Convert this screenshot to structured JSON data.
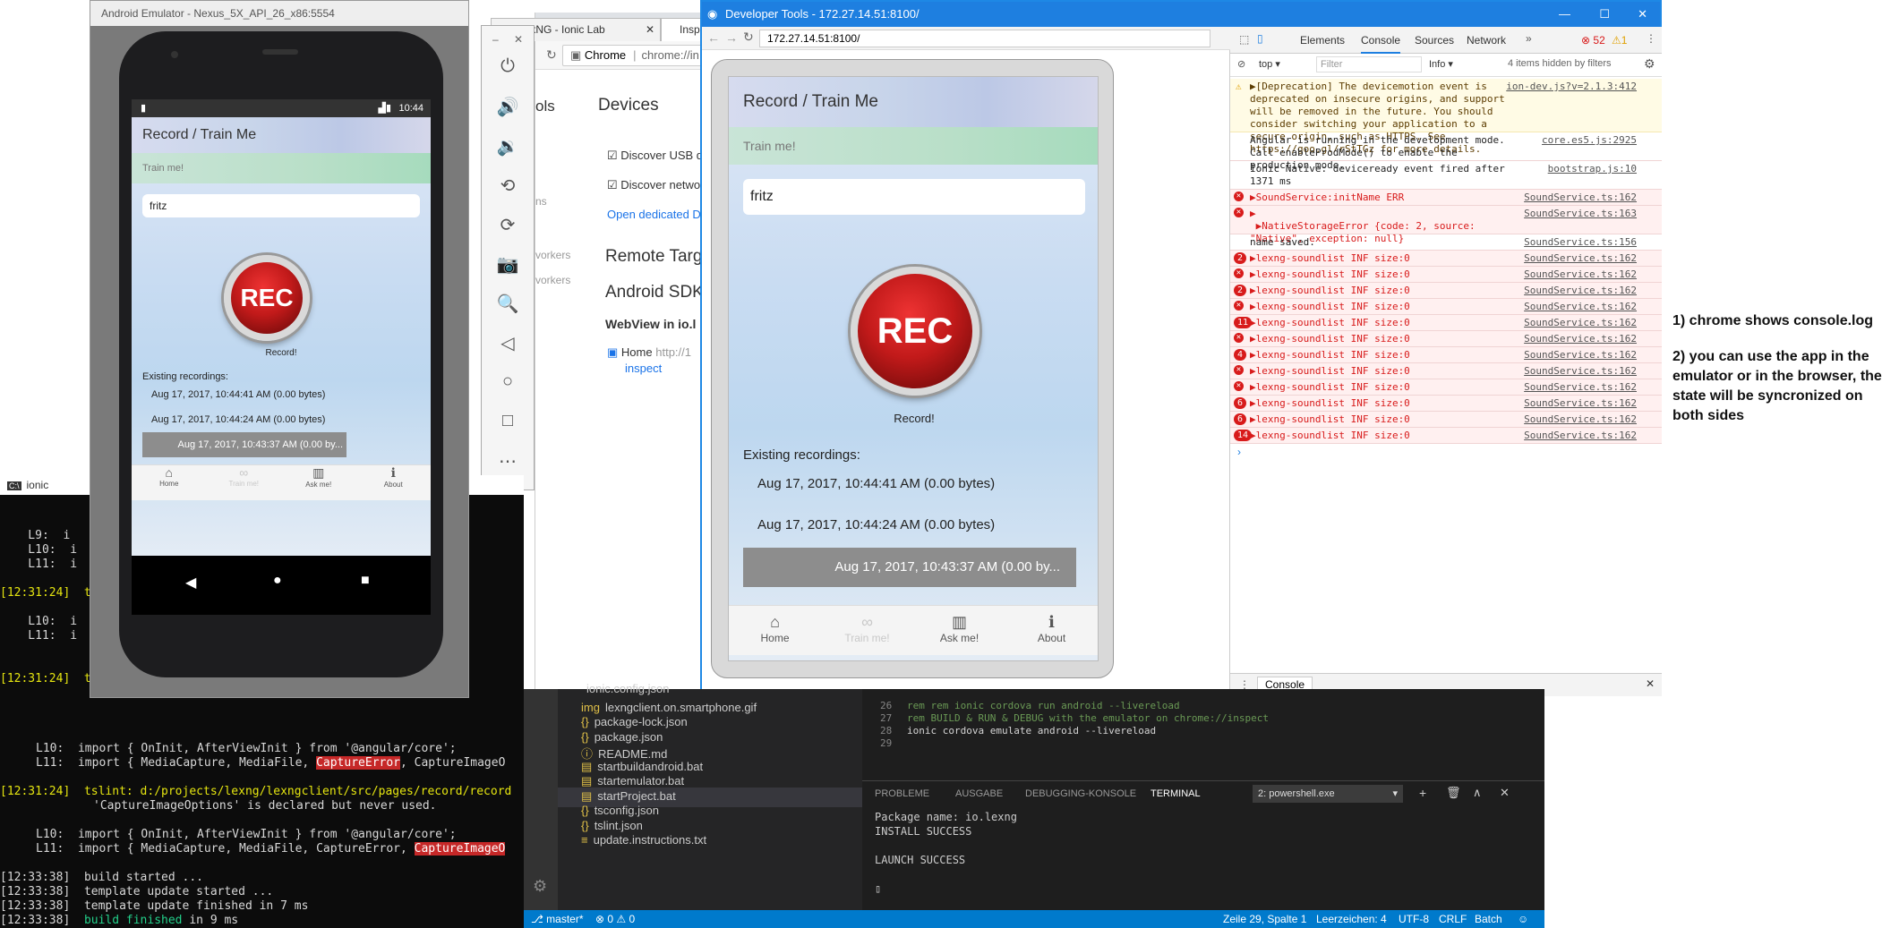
{
  "terminal": {
    "title": "ionic",
    "lines": [
      {
        "prefix": "",
        "text": "    L9:  i"
      },
      {
        "prefix": "",
        "text": "    L10:  i"
      },
      {
        "prefix": "",
        "text": "    L11:  i"
      },
      {
        "prefix": "[12:31:24]",
        "text": "  t"
      },
      {
        "prefix": "",
        "text": "    L10:  i"
      },
      {
        "prefix": "",
        "text": "    L11:  i"
      },
      {
        "prefix": "[12:31:24]",
        "text": "  t"
      }
    ],
    "code1_l10": "L10:  import { OnInit, AfterViewInit } from '@angular/core';",
    "code1_l11_a": "L11:  import { MediaCapture, MediaFile, ",
    "code1_l11_b": "CaptureError",
    "code1_l11_c": ", CaptureImageO",
    "tslint_time": "[12:31:24]",
    "tslint_msg": "tslint: d:/projects/lexng/lexngclient/src/pages/record/record",
    "tslint_msg2": "'CaptureImageOptions' is declared but never used.",
    "code2_l10": "L10:  import { OnInit, AfterViewInit } from '@angular/core';",
    "code2_l11_a": "L11:  import { MediaCapture, MediaFile, CaptureError, ",
    "code2_l11_b": "CaptureImageO",
    "build": [
      {
        "time": "[12:33:38]",
        "msg": "build started ..."
      },
      {
        "time": "[12:33:38]",
        "msg": "template update started ..."
      },
      {
        "time": "[12:33:38]",
        "msg": "template update finished in 7 ms"
      },
      {
        "time": "[12:33:38]",
        "msg": "build finished",
        "suffix": " in 9 ms"
      }
    ]
  },
  "emulator": {
    "title": "Android Emulator - Nexus_5X_API_26_x86:5554",
    "clock": "10:44"
  },
  "app": {
    "header": "Record / Train Me",
    "subheader": "Train me!",
    "name_value": "fritz",
    "rec_label": "REC",
    "record_caption": "Record!",
    "recordings_title": "Existing recordings:",
    "recordings": [
      "Aug 17, 2017, 10:44:41 AM (0.00 bytes)",
      "Aug 17, 2017, 10:44:24 AM (0.00 bytes)"
    ],
    "selected_small": "Aug 17, 2017, 10:43:37 AM (0.00 by...",
    "selected_large": "Aug 17, 2017, 10:43:37 AM (0.00 b...",
    "tabs": [
      {
        "label": "Home",
        "icon": "home-icon",
        "glyph": "⌂"
      },
      {
        "label": "Train me!",
        "icon": "train-icon",
        "glyph": "∞"
      },
      {
        "label": "Ask me!",
        "icon": "barcode-icon",
        "glyph": "▥"
      },
      {
        "label": "About",
        "icon": "info-icon",
        "glyph": "ℹ"
      }
    ]
  },
  "browser": {
    "tab1": "lexNG - Ionic Lab",
    "tab2": "Insp",
    "omnibox_chrome": "Chrome",
    "omnibox_url": "chrome://in"
  },
  "inspect": {
    "ols": "ols",
    "devices": "Devices",
    "discover_usb": "Discover USB d",
    "discover_network": "Discover netwo",
    "open_dedicated": "Open dedicated D",
    "ns": "ns",
    "workers1": "vorkers",
    "workers2": "vorkers",
    "remote": "Remote Targ",
    "android_sdk": "Android SDK",
    "webview": "WebView in io.l",
    "home": "Home",
    "home_url": "http://1",
    "inspect_link": "inspect"
  },
  "devtools": {
    "title": "Developer Tools - 172.27.14.51:8100/",
    "url": "172.27.14.51:8100/",
    "tabs": [
      "Elements",
      "Console",
      "Sources",
      "Network"
    ],
    "error_count": "52",
    "warn_count": "1",
    "context": "top",
    "filter_placeholder": "Filter",
    "level": "Info",
    "hidden": "4 items hidden by filters",
    "drawer_tab": "Console",
    "logs": [
      {
        "type": "warn",
        "count": "",
        "text": "▶[Deprecation] The devicemotion event is deprecated on insecure origins, and support will be removed in the future. You should consider switching your application to a secure origin, such as HTTPS. See https://goo.gl/rStTGz for more details.",
        "src": "ion-dev.js?v=2.1.3:412",
        "lines": 4
      },
      {
        "type": "info",
        "count": "",
        "text": "Angular is running in the development mode. Call enableProdMode() to enable the production mode.",
        "src": "core.es5.js:2925",
        "lines": 2
      },
      {
        "type": "info",
        "count": "",
        "text": "Ionic Native: deviceready event fired after 1371 ms",
        "src": "bootstrap.js:10",
        "lines": 2
      },
      {
        "type": "err",
        "count": "x",
        "text": "▶SoundService:initName ERR",
        "src": "SoundService.ts:162",
        "lines": 1
      },
      {
        "type": "err",
        "count": "x",
        "text": "▶\n ▶NativeStorageError {code: 2, source: \"Native\", exception: null}",
        "src": "SoundService.ts:163",
        "lines": 2
      },
      {
        "type": "info",
        "count": "",
        "text": "name saved.",
        "src": "SoundService.ts:156",
        "lines": 1
      },
      {
        "type": "err",
        "count": "2",
        "text": "▶lexng-soundlist INF size:0",
        "src": "SoundService.ts:162",
        "lines": 1
      },
      {
        "type": "err",
        "count": "x",
        "text": "▶lexng-soundlist INF size:0",
        "src": "SoundService.ts:162",
        "lines": 1
      },
      {
        "type": "err",
        "count": "2",
        "text": "▶lexng-soundlist INF size:0",
        "src": "SoundService.ts:162",
        "lines": 1
      },
      {
        "type": "err",
        "count": "x",
        "text": "▶lexng-soundlist INF size:0",
        "src": "SoundService.ts:162",
        "lines": 1
      },
      {
        "type": "err",
        "count": "11",
        "text": "▶lexng-soundlist INF size:0",
        "src": "SoundService.ts:162",
        "lines": 1
      },
      {
        "type": "err",
        "count": "x",
        "text": "▶lexng-soundlist INF size:0",
        "src": "SoundService.ts:162",
        "lines": 1
      },
      {
        "type": "err",
        "count": "4",
        "text": "▶lexng-soundlist INF size:0",
        "src": "SoundService.ts:162",
        "lines": 1
      },
      {
        "type": "err",
        "count": "x",
        "text": "▶lexng-soundlist INF size:0",
        "src": "SoundService.ts:162",
        "lines": 1
      },
      {
        "type": "err",
        "count": "x",
        "text": "▶lexng-soundlist INF size:0",
        "src": "SoundService.ts:162",
        "lines": 1
      },
      {
        "type": "err",
        "count": "6",
        "text": "▶lexng-soundlist INF size:0",
        "src": "SoundService.ts:162",
        "lines": 1
      },
      {
        "type": "err",
        "count": "6",
        "text": "▶lexng-soundlist INF size:0",
        "src": "SoundService.ts:162",
        "lines": 1
      },
      {
        "type": "err",
        "count": "14",
        "text": "▶lexng-soundlist INF size:0",
        "src": "SoundService.ts:162",
        "lines": 1
      }
    ]
  },
  "vscode": {
    "files": [
      {
        "icon": "",
        "name": "ionic.config.json"
      },
      {
        "icon": "img",
        "name": "lexngclient.on.smartphone.gif"
      },
      {
        "icon": "{}",
        "name": "package-lock.json"
      },
      {
        "icon": "{}",
        "name": "package.json"
      },
      {
        "icon": "ⓘ",
        "name": "README.md"
      },
      {
        "icon": "▤",
        "name": "startbuildandroid.bat"
      },
      {
        "icon": "▤",
        "name": "startemulator.bat"
      },
      {
        "icon": "▤",
        "name": "startProject.bat"
      },
      {
        "icon": "{}",
        "name": "tsconfig.json"
      },
      {
        "icon": "{}",
        "name": "tslint.json"
      },
      {
        "icon": "≡",
        "name": "update.instructions.txt"
      }
    ],
    "editor_lines": [
      {
        "num": "26",
        "text": "rem rem ionic cordova run android --livereload",
        "cls": "cm"
      },
      {
        "num": "27",
        "text": "rem BUILD & RUN & DEBUG with the emulator on chrome://inspect",
        "cls": "cm"
      },
      {
        "num": "28",
        "text": "ionic cordova emulate android --livereload",
        "cls": "pl"
      },
      {
        "num": "29",
        "text": "",
        "cls": "pl"
      }
    ],
    "panel_tabs": [
      "PROBLEME",
      "AUSGABE",
      "DEBUGGING-KONSOLE",
      "TERMINAL"
    ],
    "shell": "2: powershell.exe",
    "terminal_lines": [
      "Package name: io.lexng",
      "INSTALL SUCCESS",
      "",
      "LAUNCH SUCCESS"
    ],
    "status": {
      "branch": "master*",
      "errors": "0",
      "warnings": "0",
      "position": "Zeile 29, Spalte 1",
      "indent": "Leerzeichen: 4",
      "encoding": "UTF-8",
      "eol": "CRLF",
      "lang": "Batch"
    }
  },
  "note": {
    "line1": "1) chrome shows console.log",
    "line2": "2) you can use the app in the emulator or in the browser, the state will be syncronized on both sides"
  },
  "colors": {
    "accent": "#1e7fe0",
    "error": "#d81b1b",
    "vscode_status": "#007acc"
  }
}
